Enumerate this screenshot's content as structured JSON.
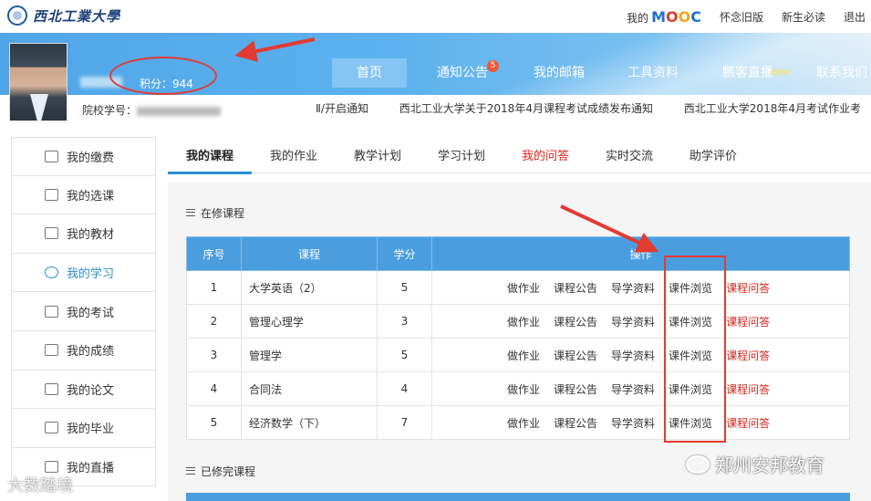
{
  "header": {
    "university": "西北工業大學",
    "mooc_prefix": "我的",
    "mooc_letters": [
      "M",
      "O",
      "O",
      "C"
    ],
    "links": [
      "怀念旧版",
      "新生必读",
      "退出"
    ]
  },
  "profile": {
    "points": "积分：944",
    "student_id_label": "院校学号："
  },
  "nav": {
    "items": [
      {
        "label": "首页",
        "badge": ""
      },
      {
        "label": "通知公告",
        "badge": "5"
      },
      {
        "label": "我的邮箱",
        "badge": ""
      },
      {
        "label": "工具资料",
        "badge": ""
      },
      {
        "label": "鹏客直播",
        "badge": "",
        "tag": "NEW"
      },
      {
        "label": "联系我们",
        "badge": ""
      }
    ]
  },
  "notices": [
    "Ⅱ/开启通知",
    "西北工业大学关于2018年4月课程考试成绩发布通知",
    "西北工业大学2018年4月考试作业考"
  ],
  "sidebar": {
    "items": [
      {
        "label": "我的缴费",
        "icon": "payment-icon"
      },
      {
        "label": "我的选课",
        "icon": "grid-icon"
      },
      {
        "label": "我的教材",
        "icon": "book-icon"
      },
      {
        "label": "我的学习",
        "icon": "study-icon",
        "active": true
      },
      {
        "label": "我的考试",
        "icon": "exam-icon"
      },
      {
        "label": "我的成绩",
        "icon": "chart-icon"
      },
      {
        "label": "我的论文",
        "icon": "paper-icon"
      },
      {
        "label": "我的毕业",
        "icon": "graduation-icon"
      },
      {
        "label": "我的直播",
        "icon": "live-icon"
      }
    ]
  },
  "tabs": [
    "我的课程",
    "我的作业",
    "教学计划",
    "学习计划",
    "我的问答",
    "实时交流",
    "助学评价"
  ],
  "current_section": "在修课程",
  "completed_section": "已修完课程",
  "table": {
    "headers": [
      "序号",
      "课程",
      "学分",
      "操作"
    ],
    "ops": [
      "做作业",
      "课程公告",
      "导学资料",
      "课件浏览",
      "课程问答"
    ],
    "rows": [
      {
        "no": "1",
        "course": "大学英语（2）",
        "credit": "5"
      },
      {
        "no": "2",
        "course": "管理心理学",
        "credit": "3"
      },
      {
        "no": "3",
        "course": "管理学",
        "credit": "5"
      },
      {
        "no": "4",
        "course": "合同法",
        "credit": "4"
      },
      {
        "no": "5",
        "course": "经济数学（下）",
        "credit": "7"
      }
    ]
  },
  "watermarks": {
    "right": "郑州安邦教育",
    "left": "大数踏境"
  },
  "colors": {
    "banner": "#5cb2ee",
    "table_header": "#4a9ee0",
    "accent_red": "#d9261c",
    "annotation": "#e13b32"
  }
}
